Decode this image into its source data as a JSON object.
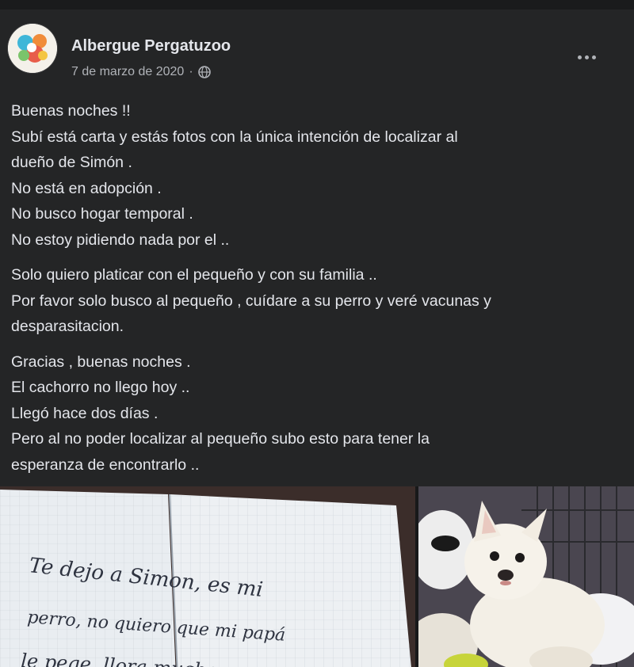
{
  "post": {
    "page_name": "Albergue Pergatuzoo",
    "date": "7 de marzo de 2020",
    "separator": "·",
    "privacy_icon": "globe-icon",
    "more_icon": "more-options-icon",
    "paragraphs": [
      [
        "Buenas noches !!",
        "Subí está carta y estás fotos con la única intención de localizar al",
        "dueño de Simón .",
        "No está en adopción .",
        "No busco hogar temporal .",
        "No estoy pidiendo nada por el .."
      ],
      [
        "Solo quiero platicar con el pequeño y con su familia ..",
        "Por favor solo busco al pequeño , cuídare a su perro y veré vacunas y",
        "desparasitacion."
      ],
      [
        "Gracias , buenas noches .",
        "El cachorro no llego hoy ..",
        "Llegó hace dos días .",
        "Pero al no poder localizar al pequeño subo esto para tener la",
        "esperanza de encontrarlo .."
      ]
    ],
    "letter_photo": {
      "handwritten_lines": [
        "Te dejo a Simon, es mi",
        "perro, no quiero que mi papá",
        "le pege, llora mucho porque"
      ]
    },
    "dog_photo": {
      "icon": "puppy-photo"
    }
  },
  "colors": {
    "background": "#242526",
    "text_primary": "#e4e6eb",
    "text_secondary": "#b0b3b8"
  }
}
